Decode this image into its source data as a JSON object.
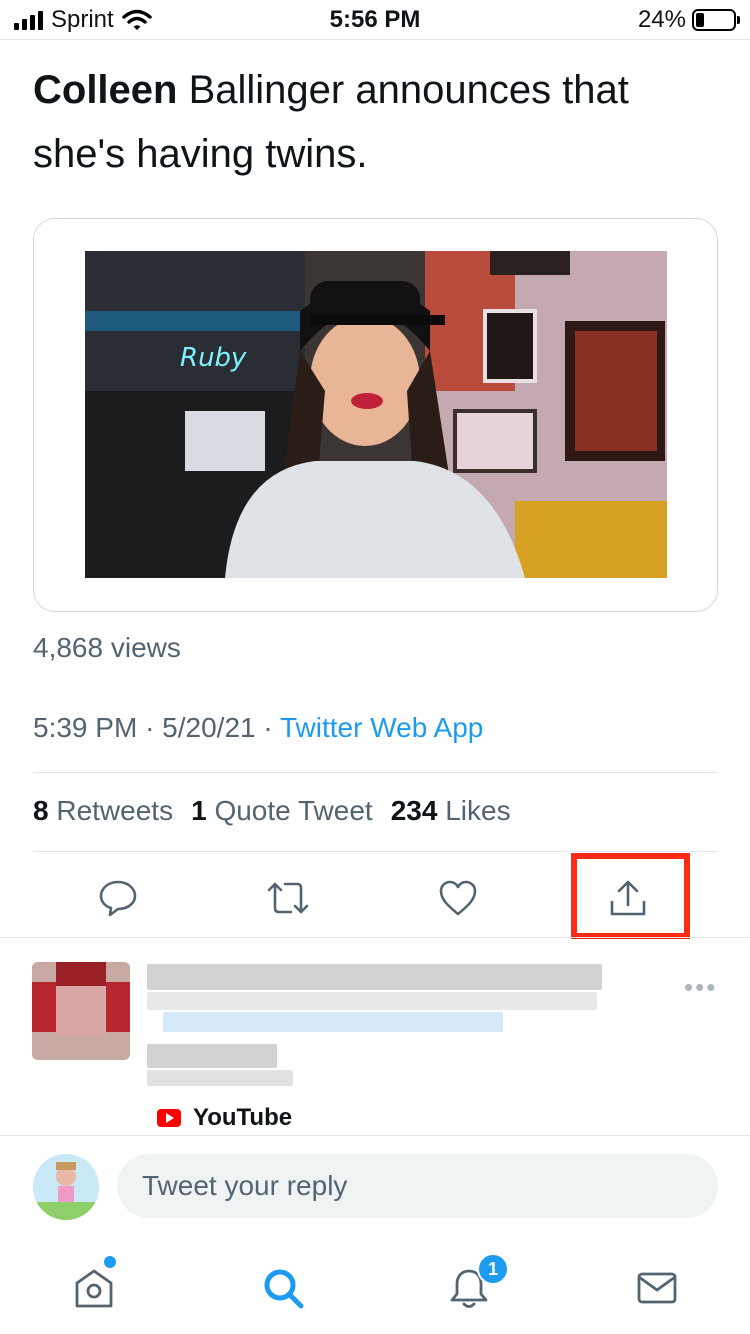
{
  "status_bar": {
    "carrier": "Sprint",
    "time": "5:56 PM",
    "battery": "24%"
  },
  "tweet": {
    "text_bold": "Colleen",
    "text_rest": " Ballinger announces that she's having twins.",
    "views": "4,868 views",
    "time": "5:39 PM",
    "date": "5/20/21",
    "separator": "·",
    "source": "Twitter Web App"
  },
  "stats": {
    "retweets_count": "8",
    "retweets_label": "Retweets",
    "quotes_count": "1",
    "quotes_label": "Quote Tweet",
    "likes_count": "234",
    "likes_label": "Likes"
  },
  "reply": {
    "more": "•••",
    "source_label": "YouTube"
  },
  "composer": {
    "placeholder": "Tweet your reply"
  },
  "tab_bar": {
    "notification_count": "1"
  },
  "colors": {
    "accent": "#1d9bf0",
    "highlight": "#ff2b13"
  }
}
